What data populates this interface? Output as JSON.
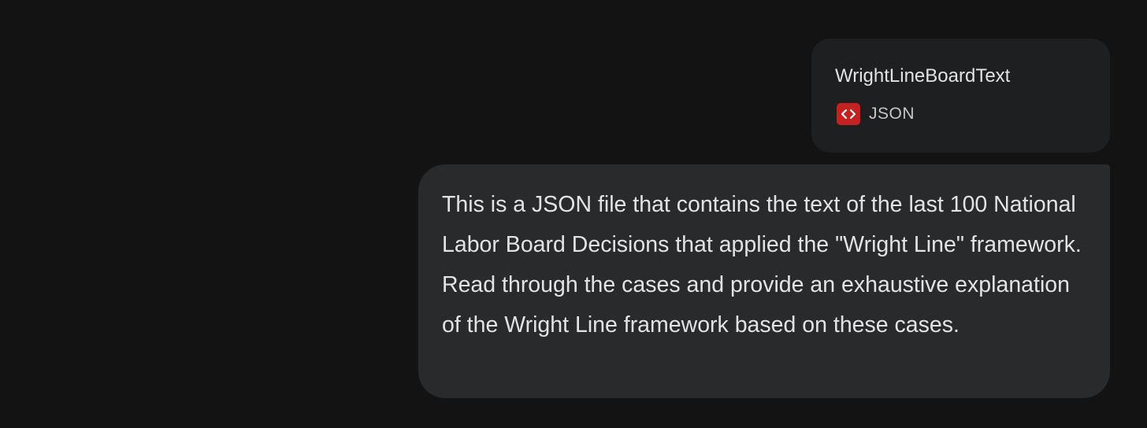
{
  "attachment": {
    "file_name": "WrightLineBoardText",
    "file_type": "JSON",
    "icon": "code-icon",
    "icon_color": "#c5221f"
  },
  "message": {
    "text": "This is a JSON file that contains the text of the last 100 National Labor Board Decisions that applied the \"Wright Line\" framework. Read through the cases and provide an exhaustive explanation of the Wright Line framework based on these cases."
  },
  "colors": {
    "background": "#131314",
    "card_background": "#1e1f20",
    "bubble_background": "#282a2c",
    "text": "#e3e3e3"
  }
}
